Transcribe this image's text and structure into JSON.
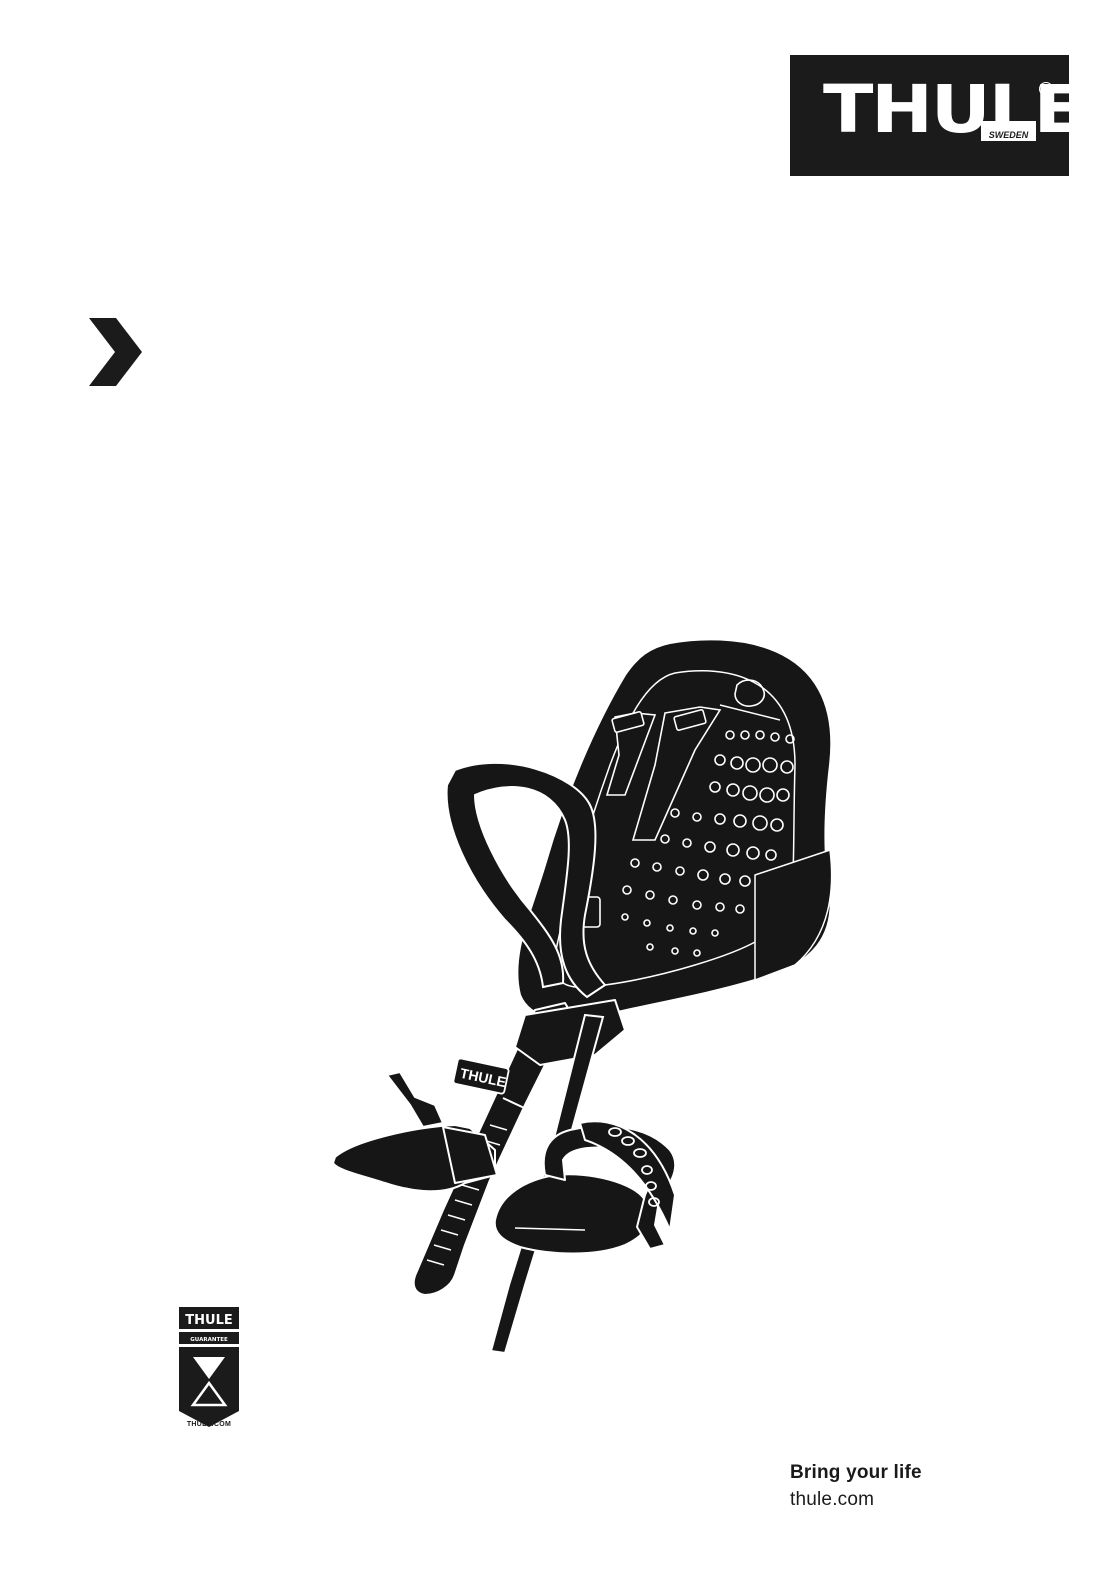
{
  "brand": {
    "logo_word": "THULE",
    "logo_sub": "SWEDEN",
    "logo_reg": "R"
  },
  "icons": {
    "chevron": "chevron-right-icon",
    "guarantee": "thule-guarantee-badge"
  },
  "guarantee_badge": {
    "brand": "THULE",
    "label": "GUARANTEE",
    "url": "THULE.COM"
  },
  "footer": {
    "tagline": "Bring your life",
    "website": "thule.com"
  },
  "colors": {
    "ink": "#1b1b1b",
    "paper": "#ffffff"
  }
}
